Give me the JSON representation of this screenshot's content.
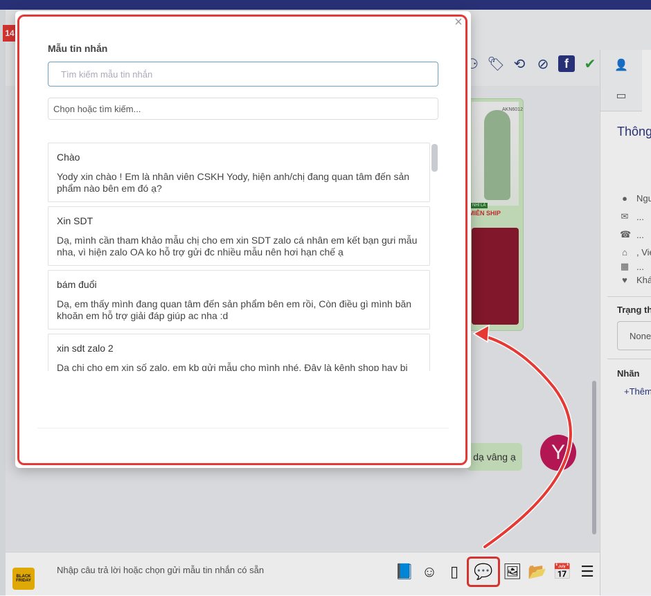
{
  "background": {
    "badge_number": "14",
    "reply_bubble": "dạ vâng ạ",
    "avatar_letter": "Y",
    "product": {
      "code": "AKN6012",
      "tag": "NHÌ LÀ",
      "label": "MIỄN SHIP"
    }
  },
  "right_panel": {
    "title": "Thông",
    "rows": [
      {
        "icon": "user-icon",
        "text": "Ngu"
      },
      {
        "icon": "envelope-icon",
        "text": "..."
      },
      {
        "icon": "phone-icon",
        "text": "..."
      },
      {
        "icon": "home-icon",
        "text": ", Vie"
      },
      {
        "icon": "cake-icon",
        "text": "..."
      },
      {
        "icon": "heart-icon",
        "text": "Khá"
      }
    ],
    "status_label": "Trạng th",
    "status_value": "None",
    "tags_label": "Nhãn",
    "add_tag": "+Thêm"
  },
  "modal": {
    "title": "Mẫu tin nhắn",
    "search_placeholder": "Tìm kiếm mẫu tin nhắn",
    "select_placeholder": "Chọn hoặc tìm kiếm...",
    "templates": [
      {
        "title": "Chào",
        "body": "Yody xin chào ! Em là nhân viên CSKH Yody, hiện anh/chị đang quan tâm đến sản phẩm nào bên em đó ạ?"
      },
      {
        "title": "Xin SDT",
        "body": "Dạ, mình cần tham khảo mẫu chị cho em xin SDT zalo cá nhân em kết bạn gưi mẫu nha, vì hiện zalo OA ko hỗ trợ gửi đc nhiều mẫu nên hơi hạn chế ạ"
      },
      {
        "title": "bám đuổi",
        "body": "Dạ, em thấy mình đang quan tâm đến sản phẩm bên em rồi, Còn điều gì mình băn khoăn em hỗ trợ giải đáp giúp ac nha :d"
      },
      {
        "title": "xin sdt zalo 2",
        "body": "Dạ chị cho em xin số zalo, em kb gửi mẫu cho mình nhé. Đây là kênh shop hay bị trôi tin nhắn ạ"
      }
    ]
  },
  "composer": {
    "placeholder": "Nhập câu trả lời hoặc chọn gửi mẫu tin nhắn có sẵn",
    "logo_text": "BLACK FRIDAY"
  },
  "accent_colors": {
    "primary": "#2c3680",
    "highlight": "#e53935",
    "bubble": "#cfe9c4"
  }
}
